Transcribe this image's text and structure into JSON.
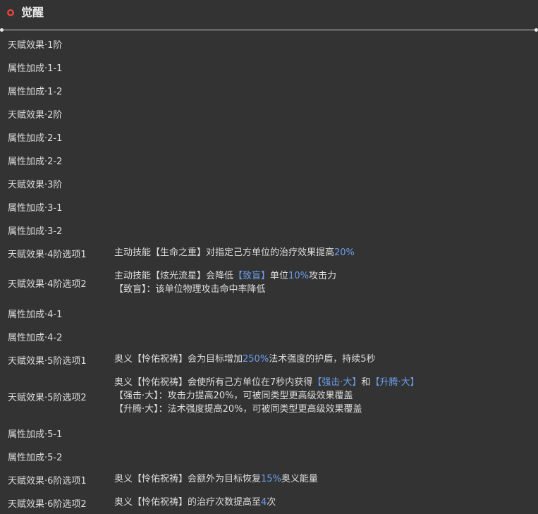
{
  "header": {
    "title": "觉醒",
    "icon": "awakening-badge-icon",
    "icon_color": "#e0443c"
  },
  "colors": {
    "background": "#333333",
    "text": "#dedede",
    "highlight": "#6d9eeb"
  },
  "rows": [
    {
      "label": "天赋效果·1阶",
      "desc": []
    },
    {
      "label": "属性加成·1-1",
      "desc": []
    },
    {
      "label": "属性加成·1-2",
      "desc": []
    },
    {
      "label": "天赋效果·2阶",
      "desc": []
    },
    {
      "label": "属性加成·2-1",
      "desc": []
    },
    {
      "label": "属性加成·2-2",
      "desc": []
    },
    {
      "label": "天赋效果·3阶",
      "desc": []
    },
    {
      "label": "属性加成·3-1",
      "desc": []
    },
    {
      "label": "属性加成·3-2",
      "desc": []
    },
    {
      "label": "天赋效果·4阶选项1",
      "desc": [
        [
          {
            "t": "主动技能【生命之重】对指定己方单位的治疗效果提高"
          },
          {
            "t": "20%",
            "hl": true
          }
        ]
      ]
    },
    {
      "label": "天赋效果·4阶选项2",
      "desc": [
        [
          {
            "t": "主动技能【炫光流星】会降低"
          },
          {
            "t": "【致盲】",
            "hl": true
          },
          {
            "t": "单位"
          },
          {
            "t": "10%",
            "hl": true
          },
          {
            "t": "攻击力"
          }
        ],
        [
          {
            "t": "【致盲】：该单位物理攻击命中率降低"
          }
        ]
      ]
    },
    {
      "label": "属性加成·4-1",
      "desc": []
    },
    {
      "label": "属性加成·4-2",
      "desc": []
    },
    {
      "label": "天赋效果·5阶选项1",
      "desc": [
        [
          {
            "t": "奥义【怜佑祝祷】会为目标增加"
          },
          {
            "t": "250%",
            "hl": true
          },
          {
            "t": "法术强度的护盾，持续5秒"
          }
        ]
      ]
    },
    {
      "label": "天赋效果·5阶选项2",
      "desc": [
        [
          {
            "t": "奥义【怜佑祝祷】会使所有己方单位在7秒内获得"
          },
          {
            "t": "【强击·大】",
            "hl": true
          },
          {
            "t": "和"
          },
          {
            "t": "【升腾·大】",
            "hl": true
          }
        ],
        [
          {
            "t": "【强击·大】：攻击力提高20%，可被同类型更高级效果覆盖"
          }
        ],
        [
          {
            "t": "【升腾·大】：法术强度提高20%，可被同类型更高级效果覆盖"
          }
        ]
      ]
    },
    {
      "label": "属性加成·5-1",
      "desc": []
    },
    {
      "label": "属性加成·5-2",
      "desc": []
    },
    {
      "label": "天赋效果·6阶选项1",
      "desc": [
        [
          {
            "t": "奥义【怜佑祝祷】会额外为目标恢复"
          },
          {
            "t": "15%",
            "hl": true
          },
          {
            "t": "奥义能量"
          }
        ]
      ]
    },
    {
      "label": "天赋效果·6阶选项2",
      "desc": [
        [
          {
            "t": "奥义【怜佑祝祷】的治疗次数提高至"
          },
          {
            "t": "4",
            "hl": true
          },
          {
            "t": "次"
          }
        ]
      ]
    }
  ]
}
